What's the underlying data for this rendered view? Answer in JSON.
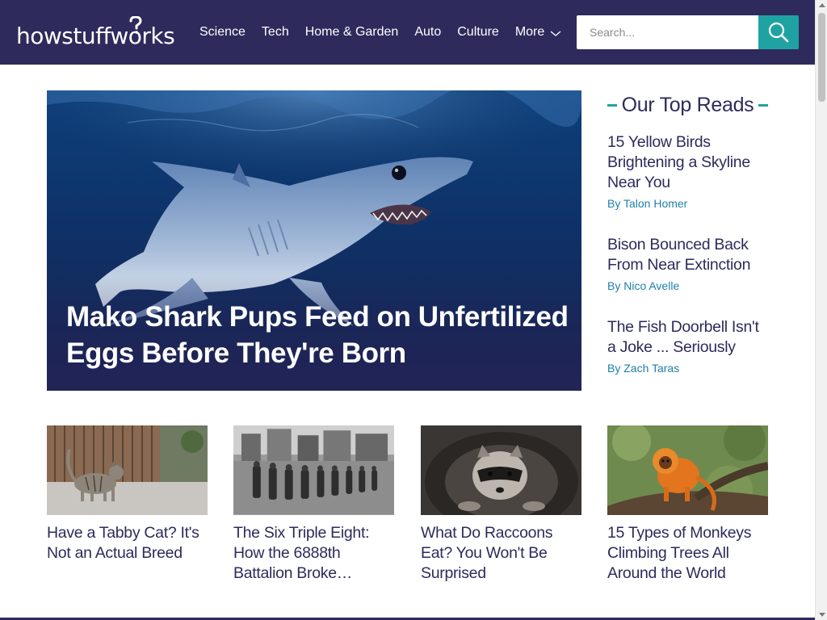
{
  "header": {
    "logo": "howstuffworks",
    "nav": [
      "Science",
      "Tech",
      "Home & Garden",
      "Auto",
      "Culture",
      "More"
    ],
    "search_placeholder": "Search..."
  },
  "hero": {
    "title": "Mako Shark Pups Feed on Unfertilized Eggs Before They're Born"
  },
  "top_reads": {
    "heading": "Our Top Reads",
    "items": [
      {
        "title": "15 Yellow Birds Brightening a Skyline Near You",
        "author": "By Talon Homer"
      },
      {
        "title": "Bison Bounced Back From Near Extinction",
        "author": "By Nico Avelle"
      },
      {
        "title": "The Fish Doorbell Isn't a Joke ... Seriously",
        "author": "By Zach Taras"
      }
    ]
  },
  "cards": [
    {
      "title": "Have a Tabby Cat? It's Not an Actual Breed"
    },
    {
      "title": "The Six Triple Eight: How the 6888th Battalion Broke…"
    },
    {
      "title": "What Do Raccoons Eat? You Won't Be Surprised"
    },
    {
      "title": "15 Types of Monkeys Climbing Trees All Around the World"
    }
  ],
  "colors": {
    "header_bg": "#2e2a5c",
    "accent": "#1fa3a2",
    "text": "#2d2b5c",
    "author_link": "#1f7fa8"
  },
  "icons": [
    "search-icon",
    "chevron-down-icon"
  ]
}
